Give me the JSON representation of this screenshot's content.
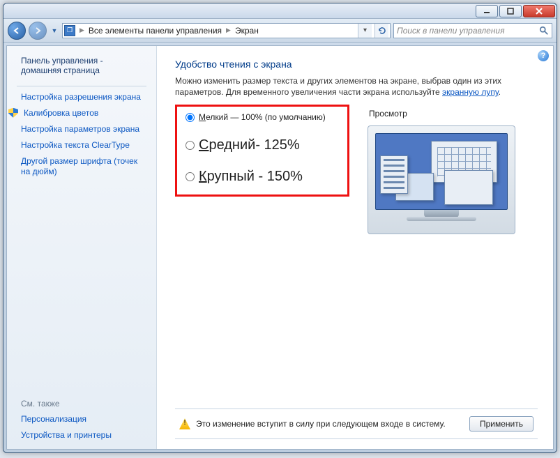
{
  "breadcrumb": {
    "root": "Все элементы панели управления",
    "current": "Экран"
  },
  "search": {
    "placeholder": "Поиск в панели управления"
  },
  "sidebar": {
    "home": "Панель управления - домашняя страница",
    "links": [
      {
        "label": "Настройка разрешения экрана",
        "shield": false
      },
      {
        "label": "Калибровка цветов",
        "shield": true
      },
      {
        "label": "Настройка параметров экрана",
        "shield": false
      },
      {
        "label": "Настройка текста ClearType",
        "shield": false
      },
      {
        "label": "Другой размер шрифта (точек на дюйм)",
        "shield": false
      }
    ],
    "see_also_title": "См. также",
    "see_also": [
      {
        "label": "Персонализация"
      },
      {
        "label": "Устройства и принтеры"
      }
    ]
  },
  "main": {
    "title": "Удобство чтения с экрана",
    "desc_pre": "Можно изменить размер текста и других элементов на экране, выбрав один из этих параметров. Для временного увеличения части экрана используйте ",
    "desc_link": "экранную лупу",
    "desc_post": ".",
    "options": [
      {
        "u": "М",
        "rest": "елкий — 100% (по умолчанию)",
        "big": false,
        "checked": true
      },
      {
        "u": "С",
        "rest": "редний- 125%",
        "big": true,
        "checked": false
      },
      {
        "u": "К",
        "rest": "рупный - 150%",
        "big": true,
        "checked": false
      }
    ],
    "preview_title": "Просмотр",
    "notice": "Это изменение вступит в силу при следующем входе в систему.",
    "apply": "Применить"
  }
}
